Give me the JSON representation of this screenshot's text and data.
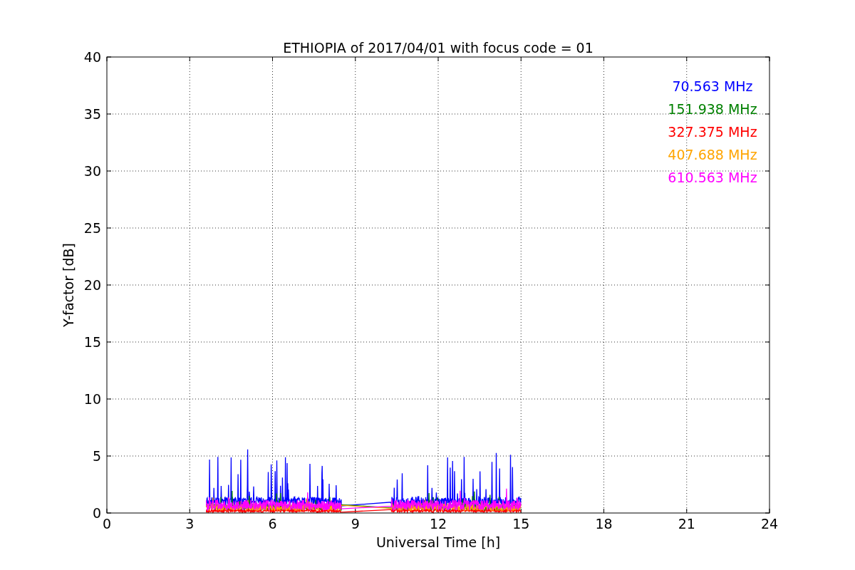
{
  "chart": {
    "title": "ETHIOPIA of 2017/04/01 with focus code = 01",
    "xlabel": "Universal Time [h]",
    "ylabel": "Y-factor [dB]",
    "xticks": [
      "0",
      "3",
      "6",
      "9",
      "12",
      "15",
      "18",
      "21",
      "24"
    ],
    "yticks": [
      "40",
      "35",
      "30",
      "25",
      "20",
      "15",
      "10",
      "5",
      "0"
    ],
    "series": [
      {
        "label": "70.563 MHz",
        "color": "#0000ff"
      },
      {
        "label": "151.938 MHz",
        "color": "#008000"
      },
      {
        "label": "327.375 MHz",
        "color": "#ff0000"
      },
      {
        "label": "407.688 MHz",
        "color": "#ffa500"
      },
      {
        "label": "610.563 MHz",
        "color": "#ff00ff"
      }
    ]
  }
}
